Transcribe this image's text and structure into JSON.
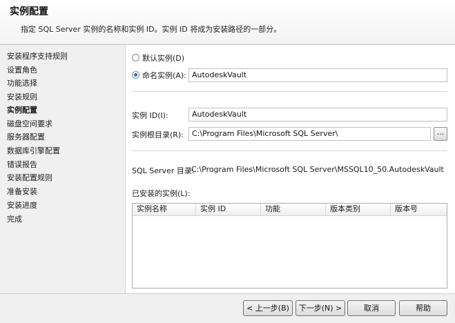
{
  "header": {
    "title": "实例配置",
    "description": "指定 SQL Server 实例的名称和实例 ID。实例 ID 将成为安装路径的一部分。"
  },
  "sidebar": {
    "items": [
      {
        "label": "安装程序支持规则"
      },
      {
        "label": "设置角色"
      },
      {
        "label": "功能选择"
      },
      {
        "label": "安装规则"
      },
      {
        "label": "实例配置",
        "active": true
      },
      {
        "label": "磁盘空间要求"
      },
      {
        "label": "服务器配置"
      },
      {
        "label": "数据库引擎配置"
      },
      {
        "label": "错误报告"
      },
      {
        "label": "安装配置规则"
      },
      {
        "label": "准备安装"
      },
      {
        "label": "安装进度"
      },
      {
        "label": "完成"
      }
    ]
  },
  "main": {
    "default_instance_label": "默认实例(D)",
    "named_instance_label": "命名实例(A):",
    "named_instance_value": "AutodeskVault",
    "selected_instance_type": "named",
    "instance_id_label": "实例 ID(I):",
    "instance_id_value": "AutodeskVault",
    "instance_root_label": "实例根目录(R):",
    "instance_root_value": "C:\\Program Files\\Microsoft SQL Server\\",
    "browse_label": "...",
    "sql_dir_label": "SQL Server 目录:",
    "sql_dir_value": "C:\\Program Files\\Microsoft SQL Server\\MSSQL10_50.AutodeskVault",
    "installed_label": "已安装的实例(L):",
    "columns": [
      "实例名称",
      "实例 ID",
      "功能",
      "版本类别",
      "版本号"
    ],
    "rows": []
  },
  "footer": {
    "back": "< 上一步(B)",
    "next": "下一步(N) >",
    "cancel": "取消",
    "help": "帮助"
  }
}
